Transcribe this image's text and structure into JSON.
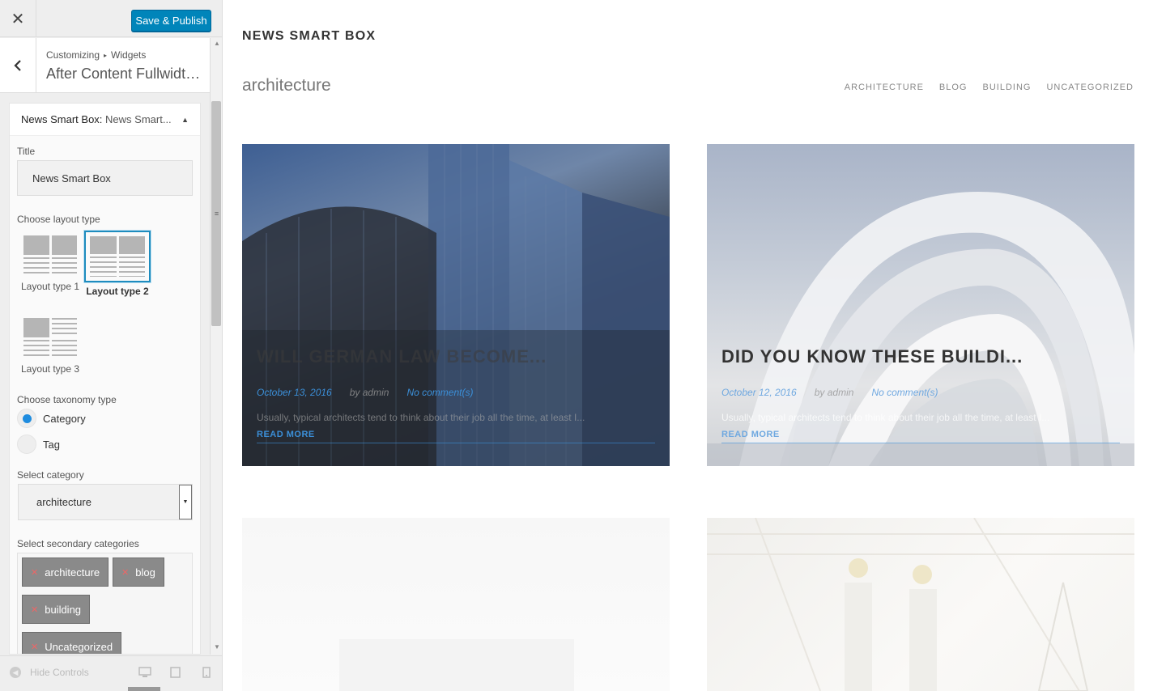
{
  "customizer": {
    "close_icon": "close-icon",
    "save_label": "Save & Publish",
    "breadcrumb": {
      "root": "Customizing",
      "separator": "▸",
      "current": "Widgets"
    },
    "section_title": "After Content Fullwidth...",
    "widget": {
      "header_name": "News Smart Box:",
      "header_subtitle": "News Smart...",
      "title_label": "Title",
      "title_value": "News Smart Box",
      "layout_label": "Choose layout type",
      "layouts": [
        {
          "label": "Layout type 1",
          "selected": false
        },
        {
          "label": "Layout type 2",
          "selected": true
        },
        {
          "label": "Layout type 3",
          "selected": false
        }
      ],
      "taxonomy_label": "Choose taxonomy type",
      "taxonomy_options": [
        {
          "label": "Category",
          "selected": true
        },
        {
          "label": "Tag",
          "selected": false
        }
      ],
      "category_label": "Select category",
      "category_value": "architecture",
      "secondary_label": "Select secondary categories",
      "secondary_tags": [
        "architecture",
        "blog",
        "building",
        "Uncategorized"
      ]
    },
    "footer": {
      "hide_controls": "Hide Controls"
    }
  },
  "preview": {
    "widget_heading": "NEWS SMART BOX",
    "box_title": "architecture",
    "category_nav": [
      "ARCHITECTURE",
      "BLOG",
      "BUILDING",
      "UNCATEGORIZED"
    ],
    "posts": [
      {
        "title": "WILL GERMAN LAW BECOME...",
        "date": "October 13, 2016",
        "author": "by admin",
        "comments": "No comment(s)",
        "excerpt": "Usually, typical architects tend to think about their job all the time, at least I...",
        "read_more": "READ MORE"
      },
      {
        "title": "DID YOU KNOW THESE BUILDI...",
        "date": "October 12, 2016",
        "author": "by admin",
        "comments": "No comment(s)",
        "excerpt": "Usually, typical architects tend to think about their job all the time, at least I...",
        "read_more": "READ MORE"
      }
    ]
  },
  "colors": {
    "accent": "#0085ba",
    "link": "#3b8fd8",
    "selection": "#1e8cbe"
  }
}
